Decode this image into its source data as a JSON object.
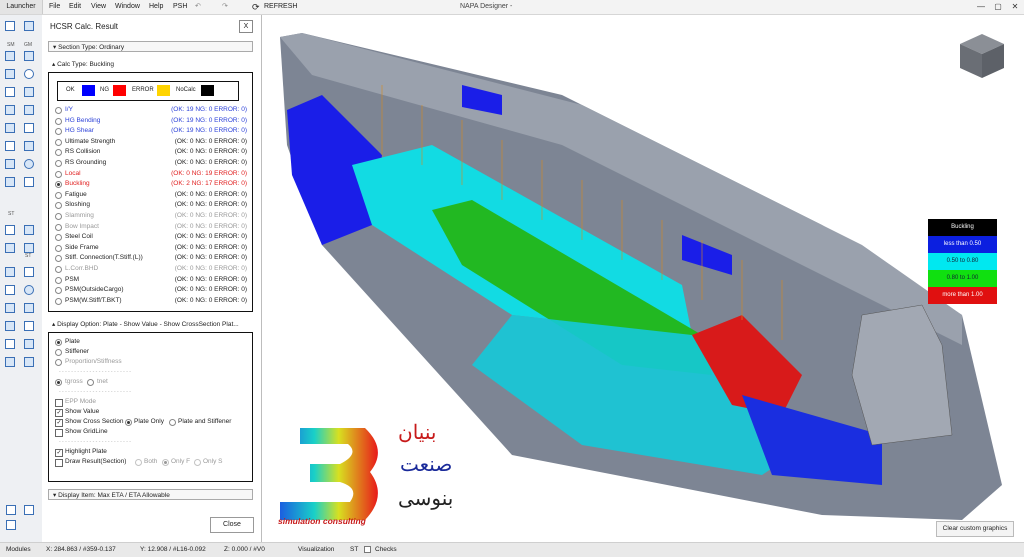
{
  "menubar": {
    "launcher": "Launcher",
    "items": [
      "File",
      "Edit",
      "View",
      "Window",
      "Help",
      "PSH"
    ],
    "refresh": "REFRESH",
    "title": "NAPA Designer -"
  },
  "toolbar": {
    "labels": [
      "SM",
      "GM",
      "ST",
      "ST"
    ]
  },
  "panel": {
    "title": "HCSR Calc. Result",
    "close": "X",
    "section_type": "Section Type: Ordinary",
    "calc_type": "Calc Type: Buckling",
    "legend": {
      "ok": "OK",
      "ng": "NG",
      "error": "ERROR",
      "nocalc": "NoCalc",
      "ok_color": "#0000ff",
      "ng_color": "#ff0000",
      "error_color": "#ffd400",
      "nocalc_color": "#000000"
    },
    "calc_items": [
      {
        "label": "I/Y",
        "status": "(OK: 19 NG: 0 ERROR: 0)",
        "state": "ok"
      },
      {
        "label": "HG Bending",
        "status": "(OK: 19 NG: 0 ERROR: 0)",
        "state": "ok"
      },
      {
        "label": "HG Shear",
        "status": "(OK: 19 NG: 0 ERROR: 0)",
        "state": "ok"
      },
      {
        "label": "Ultimate Strength",
        "status": "(OK: 0 NG: 0 ERROR: 0)",
        "state": "normal"
      },
      {
        "label": "RS Collision",
        "status": "(OK: 0 NG: 0 ERROR: 0)",
        "state": "normal"
      },
      {
        "label": "RS Grounding",
        "status": "(OK: 0 NG: 0 ERROR: 0)",
        "state": "normal"
      },
      {
        "label": "Local",
        "status": "(OK: 0 NG: 19 ERROR: 0)",
        "state": "ng"
      },
      {
        "label": "Buckling",
        "status": "(OK: 2 NG: 17 ERROR: 0)",
        "state": "ng",
        "selected": true
      },
      {
        "label": "Fatigue",
        "status": "(OK: 0 NG: 0 ERROR: 0)",
        "state": "normal"
      },
      {
        "label": "Sloshing",
        "status": "(OK: 0 NG: 0 ERROR: 0)",
        "state": "normal"
      },
      {
        "label": "Slamming",
        "status": "(OK: 0 NG: 0 ERROR: 0)",
        "state": "dim"
      },
      {
        "label": "Bow Impact",
        "status": "(OK: 0 NG: 0 ERROR: 0)",
        "state": "dim"
      },
      {
        "label": "Steel Coil",
        "status": "(OK: 0 NG: 0 ERROR: 0)",
        "state": "normal"
      },
      {
        "label": "Side Frame",
        "status": "(OK: 0 NG: 0 ERROR: 0)",
        "state": "normal"
      },
      {
        "label": "Stiff. Connection(T.Stiff.(L))",
        "status": "(OK: 0 NG: 0 ERROR: 0)",
        "state": "normal"
      },
      {
        "label": "L.Corr.BHD",
        "status": "(OK: 0 NG: 0 ERROR: 0)",
        "state": "dim"
      },
      {
        "label": "PSM",
        "status": "(OK: 0 NG: 0 ERROR: 0)",
        "state": "normal"
      },
      {
        "label": "PSM(OutsideCargo)",
        "status": "(OK: 0 NG: 0 ERROR: 0)",
        "state": "normal"
      },
      {
        "label": "PSM(W.Stiff/T.BKT)",
        "status": "(OK: 0 NG: 0 ERROR: 0)",
        "state": "normal"
      }
    ],
    "display_option": "Display Option: Plate - Show Value - Show CrossSection Plat...",
    "opts": {
      "plate": "Plate",
      "stiffener": "Stiffener",
      "proportion": "Proportion/Stiffness",
      "tgross": "tgross",
      "tnet": "tnet",
      "epp": "EPP Mode",
      "show_value": "Show Value",
      "show_cross": "Show Cross Section",
      "plate_only": "Plate Only",
      "plate_stiff": "Plate and Stiffener",
      "show_grid": "Show GridLine",
      "highlight": "Highlight Plate",
      "draw_result": "Draw Result(Section)",
      "both": "Both",
      "only_f": "Only F",
      "only_s": "Only S"
    },
    "display_item": "Display Item: Max ETA / ETA Allowable",
    "close_button": "Close"
  },
  "viewport": {
    "colorlegend": {
      "title": "Buckling",
      "rows": [
        {
          "label": "less than 0.50",
          "color": "#0b1fe0"
        },
        {
          "label": "0.50 to 0.80",
          "color": "#00e8f0"
        },
        {
          "label": "0.80 to 1.00",
          "color": "#10e010"
        },
        {
          "label": "more than 1.00",
          "color": "#e01010"
        }
      ]
    },
    "clear_btn": "Clear custom graphics",
    "logo": {
      "line1": "بنیان",
      "line2": "صنعت",
      "line3": "بنوسی",
      "tagline": "simulation consulting"
    }
  },
  "statusbar": {
    "modules": "Modules",
    "x": "X: 284.863 / #359-0.137",
    "y": "Y: 12.908 / #L16-0.092",
    "z": "Z: 0.000 / #V0",
    "visualization": "Visualization",
    "st": "ST",
    "checks": "Checks"
  }
}
